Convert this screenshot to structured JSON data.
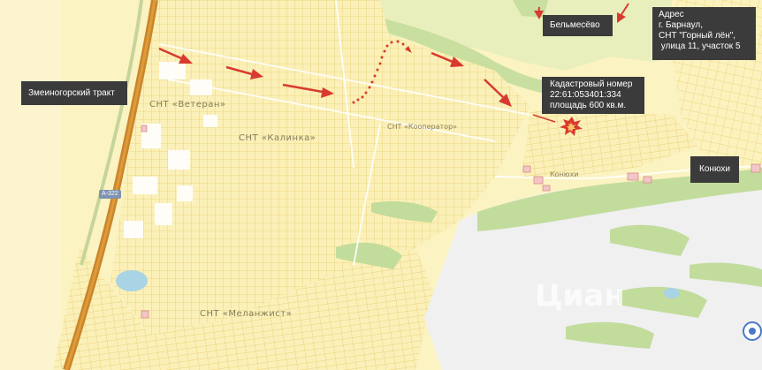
{
  "map": {
    "labels": {
      "highway": "Змеиногорский тракт",
      "belmesevo": "Бельмесёво",
      "address": [
        "Адрес",
        "г. Барнаул,",
        "СНТ \"Горный лён\",",
        " улица 11, участок 5"
      ],
      "cadastral": [
        "Кадастровый номер",
        "22:61:053401:334",
        "площадь 600 кв.м."
      ],
      "konyukhi_box": "Конюхи"
    },
    "place_names": {
      "snt_veteran": "СНТ «Ветеран»",
      "snt_kalinka": "СНТ «Калинка»",
      "snt_kooperator": "СНТ «Кооператор»",
      "snt_melanzhist": "СНТ «Меланжист»",
      "konyukhi_map": "Конюхи"
    },
    "road_shield": "А-322",
    "colors": {
      "background": "#fbf3c2",
      "plots": "#e8cf74",
      "forest": "#c2dc9c",
      "field": "#f0f0f0",
      "highway": "#c9862b",
      "arrow": "#d83a2f",
      "label_bg": "#3b3b3b"
    }
  }
}
